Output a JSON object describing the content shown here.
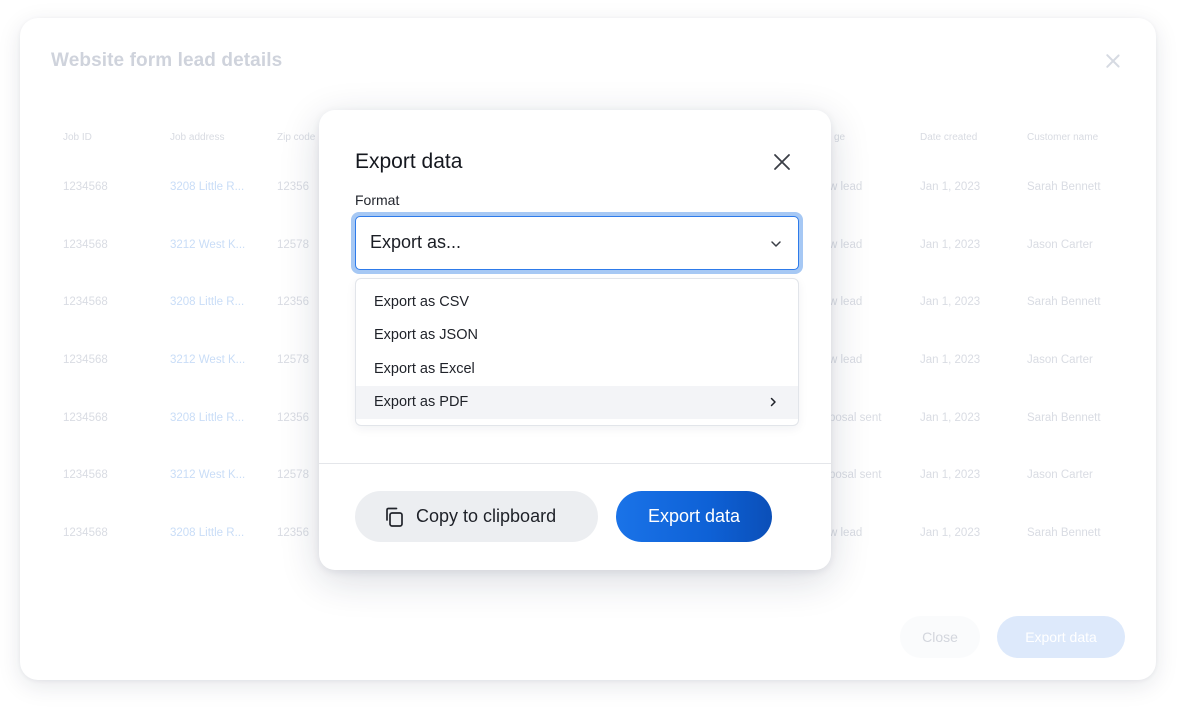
{
  "background": {
    "title": "Website form lead details",
    "columns": [
      "Job ID",
      "Job address",
      "Zip code",
      "ge",
      "Date created",
      "Customer name"
    ],
    "rows": [
      [
        "1234568",
        "3208 Little R...",
        "12356",
        "w lead",
        "Jan 1, 2023",
        "Sarah Bennett"
      ],
      [
        "1234568",
        "3212 West K...",
        "12578",
        "w lead",
        "Jan 1, 2023",
        "Jason Carter"
      ],
      [
        "1234568",
        "3208 Little R...",
        "12356",
        "w lead",
        "Jan 1, 2023",
        "Sarah Bennett"
      ],
      [
        "1234568",
        "3212 West K...",
        "12578",
        "w lead",
        "Jan 1, 2023",
        "Jason Carter"
      ],
      [
        "1234568",
        "3208 Little R...",
        "12356",
        "posal sent",
        "Jan 1, 2023",
        "Sarah Bennett"
      ],
      [
        "1234568",
        "3212 West K...",
        "12578",
        "posal sent",
        "Jan 1, 2023",
        "Jason Carter"
      ],
      [
        "1234568",
        "3208 Little R...",
        "12356",
        "w lead",
        "Jan 1, 2023",
        "Sarah Bennett"
      ]
    ],
    "close_label": "Close",
    "export_label": "Export data"
  },
  "modal": {
    "title": "Export data",
    "format_label": "Format",
    "select_value": "Export as...",
    "options": [
      {
        "label": "Export as CSV",
        "active": false
      },
      {
        "label": "Export as JSON",
        "active": false
      },
      {
        "label": "Export as Excel",
        "active": false
      },
      {
        "label": "Export as PDF",
        "active": true
      }
    ],
    "copy_label": "Copy to clipboard",
    "export_label": "Export data"
  },
  "icons": {
    "close": "close-icon",
    "chevron": "chevron-down-icon",
    "submenu": "chevron-right-icon",
    "copy": "copy-icon"
  },
  "colors": {
    "accent": "#1a73e8",
    "focus_ring": "#a6c8f4"
  }
}
